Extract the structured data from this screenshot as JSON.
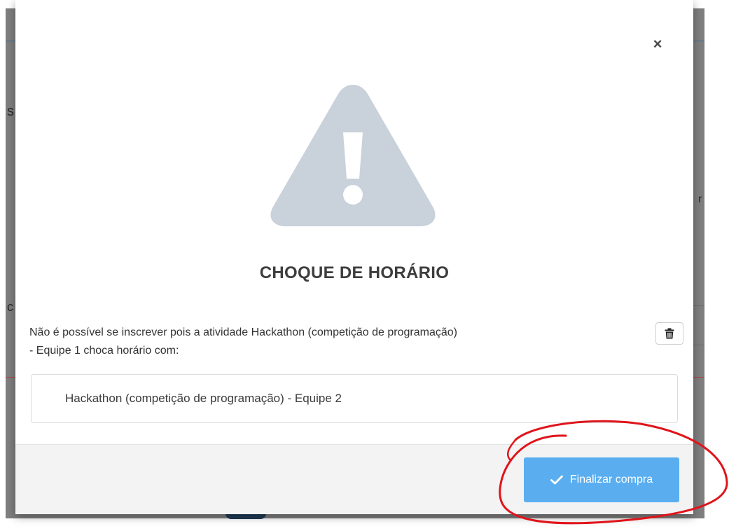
{
  "background": {
    "fragments": [
      "s",
      "c",
      "r"
    ]
  },
  "modal": {
    "close_glyph": "×",
    "icon": "warning-triangle-icon",
    "title": "CHOQUE DE HORÁRIO",
    "message_line1": "Não é possível se inscrever pois a atividade Hackathon (competição de programação)",
    "message_line2": "- Equipe 1 choca horário com:",
    "trash_icon": "trash-icon",
    "conflicts": [
      "Hackathon (competição de programação) - Equipe 2"
    ],
    "finalize_label": "Finalizar compra",
    "finalize_icon": "check-icon"
  },
  "colors": {
    "accent": "#5aaef0",
    "icon_gray": "#c9d1db",
    "annotation_red": "#e0141b"
  }
}
